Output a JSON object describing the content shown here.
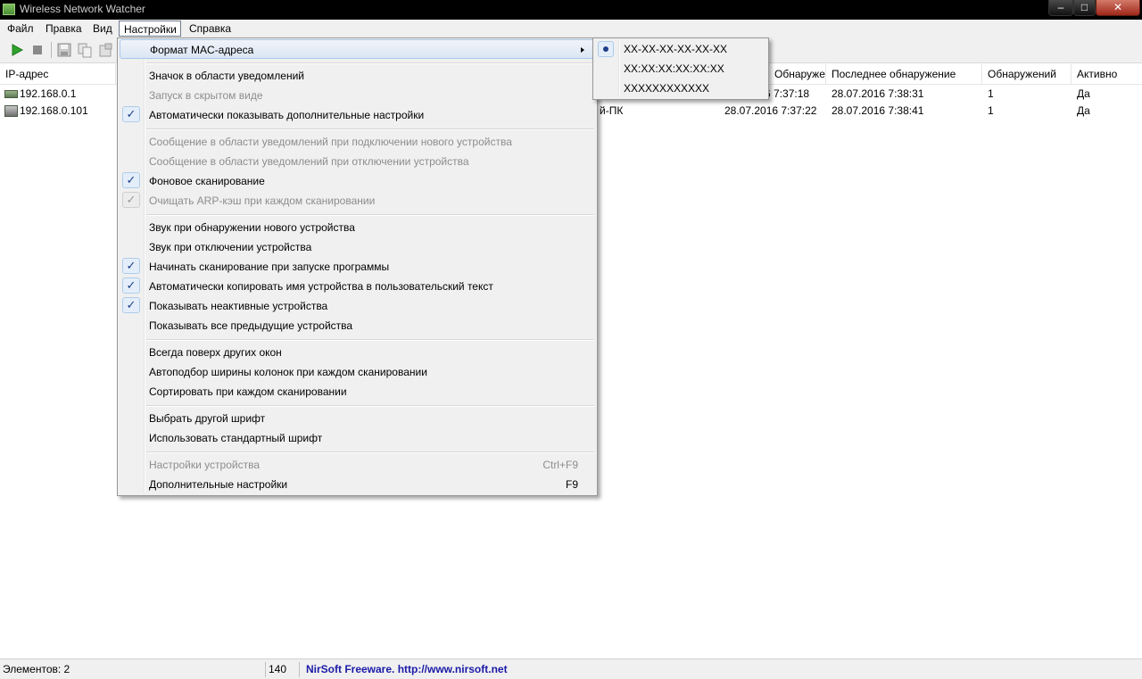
{
  "window": {
    "title": "Wireless Network Watcher",
    "minimize": "‒",
    "maximize": "□",
    "close": "✕"
  },
  "menubar": [
    "Файл",
    "Правка",
    "Вид",
    "Настройки",
    "Справка"
  ],
  "columns": [
    "IP-адрес",
    "Обнаруже...",
    "Последнее обнаружение",
    "Обнаружений",
    "Активно"
  ],
  "rows": [
    {
      "ip": "192.168.0.1",
      "name": "",
      "first": "6 7:37:18",
      "last": "28.07.2016 7:38:31",
      "count": "1",
      "active": "Да"
    },
    {
      "ip": "192.168.0.101",
      "name": "й-ПК",
      "first": "28.07.2016 7:37:22",
      "last": "28.07.2016 7:38:41",
      "count": "1",
      "active": "Да"
    }
  ],
  "menu": [
    {
      "label": "Формат MAC-адреса",
      "submenu": true,
      "highlighted": true
    },
    {
      "label": "Значок в области уведомлений"
    },
    {
      "label": "Запуск в скрытом виде",
      "disabled": true
    },
    {
      "label": "Автоматически показывать дополнительные настройки",
      "checked": true
    },
    {
      "label": "Сообщение в области уведомлений при подключении нового устройства",
      "disabled": true
    },
    {
      "label": "Сообщение в области уведомлений при отключении устройства",
      "disabled": true
    },
    {
      "label": "Фоновое сканирование",
      "checked": true
    },
    {
      "label": "Очищать ARP-кэш при каждом сканировании",
      "checked": true,
      "disabled": true
    },
    {
      "label": "Звук при обнаружении нового устройства"
    },
    {
      "label": "Звук при отключении устройства"
    },
    {
      "label": "Начинать сканирование при запуске программы",
      "checked": true
    },
    {
      "label": "Автоматически копировать имя устройства в пользовательский текст",
      "checked": true
    },
    {
      "label": "Показывать неактивные устройства",
      "checked": true
    },
    {
      "label": "Показывать все предыдущие устройства"
    },
    {
      "label": "Всегда поверх других окон"
    },
    {
      "label": "Автоподбор ширины колонок при каждом сканировании"
    },
    {
      "label": "Сортировать при каждом сканировании"
    },
    {
      "label": "Выбрать другой шрифт"
    },
    {
      "label": "Использовать стандартный шрифт"
    },
    {
      "label": "Настройки устройства",
      "shortcut": "Ctrl+F9",
      "disabled": true
    },
    {
      "label": "Дополнительные настройки",
      "shortcut": "F9"
    }
  ],
  "submenu": [
    {
      "label": "XX-XX-XX-XX-XX-XX",
      "selected": true
    },
    {
      "label": "XX:XX:XX:XX:XX:XX"
    },
    {
      "label": "XXXXXXXXXXXX"
    }
  ],
  "status": {
    "items": "Элементов: 2",
    "number": "140",
    "link": "NirSoft Freeware.  http://www.nirsoft.net"
  },
  "checkmark": "✓",
  "colors": {
    "link": "#1a1aa8",
    "menu_bg": "#f0f0f0",
    "highlight_border": "#a8c8ec",
    "play_green": "#2ea32e"
  }
}
